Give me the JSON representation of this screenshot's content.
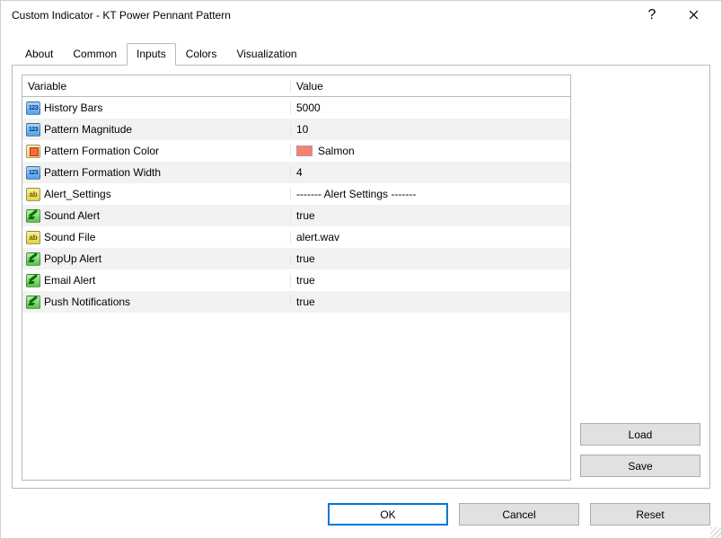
{
  "window": {
    "title": "Custom Indicator - KT Power Pennant Pattern"
  },
  "tabs": {
    "about": "About",
    "common": "Common",
    "inputs": "Inputs",
    "colors": "Colors",
    "visualization": "Visualization"
  },
  "grid": {
    "header": {
      "variable": "Variable",
      "value": "Value"
    },
    "rows": [
      {
        "icon": "int",
        "name": "History Bars",
        "value": "5000"
      },
      {
        "icon": "int",
        "name": "Pattern Magnitude",
        "value": "10"
      },
      {
        "icon": "color",
        "name": "Pattern Formation Color",
        "value": "Salmon",
        "swatch": "#fa8072"
      },
      {
        "icon": "int",
        "name": "Pattern Formation Width",
        "value": "4"
      },
      {
        "icon": "str",
        "name": "Alert_Settings",
        "value": "------- Alert Settings -------"
      },
      {
        "icon": "bool",
        "name": "Sound Alert",
        "value": "true"
      },
      {
        "icon": "str",
        "name": "Sound File",
        "value": "alert.wav"
      },
      {
        "icon": "bool",
        "name": "PopUp Alert",
        "value": "true"
      },
      {
        "icon": "bool",
        "name": "Email Alert",
        "value": "true"
      },
      {
        "icon": "bool",
        "name": "Push Notifications",
        "value": "true"
      }
    ]
  },
  "buttons": {
    "load": "Load",
    "save": "Save",
    "ok": "OK",
    "cancel": "Cancel",
    "reset": "Reset"
  }
}
